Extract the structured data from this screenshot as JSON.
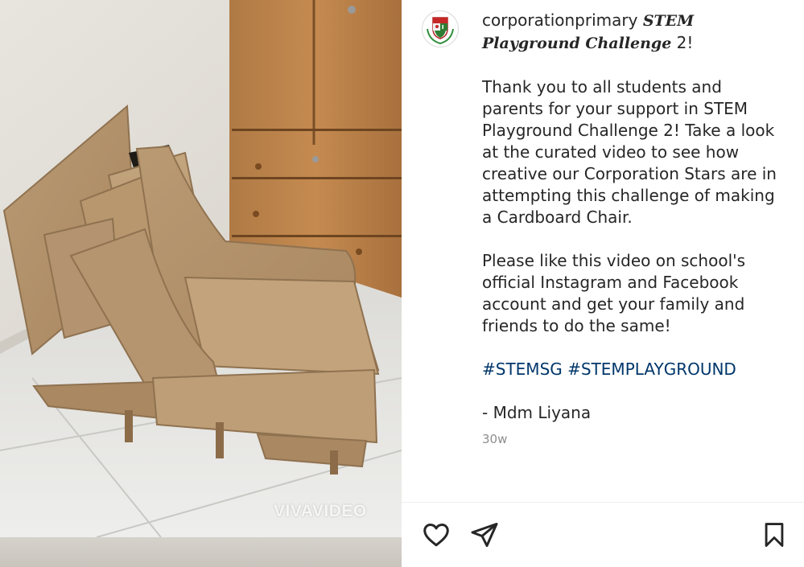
{
  "media": {
    "watermark": "VIVAVIDEO"
  },
  "post": {
    "username": "corporationprimary",
    "title_styled": "STEM Playground Challenge",
    "title_suffix": " 2!",
    "paragraph1": "Thank you to all students and parents for your support in STEM Playground Challenge 2! Take a look at the curated video to see how creative our Corporation Stars are in attempting this challenge of making a Cardboard Chair.",
    "paragraph2": "Please like this video on school's official Instagram and Facebook account and get your family and friends to do the same!",
    "hashtags": [
      "#STEMSG",
      "#STEMPLAYGROUND"
    ],
    "signoff": "- Mdm Liyana",
    "timestamp": "30w"
  },
  "actions": {
    "like_icon": "heart-outline-icon",
    "share_icon": "paper-plane-icon",
    "save_icon": "bookmark-outline-icon"
  },
  "colors": {
    "text": "#262626",
    "hashtag": "#00376b",
    "muted": "#8e8e8e",
    "divider": "#efefef"
  }
}
